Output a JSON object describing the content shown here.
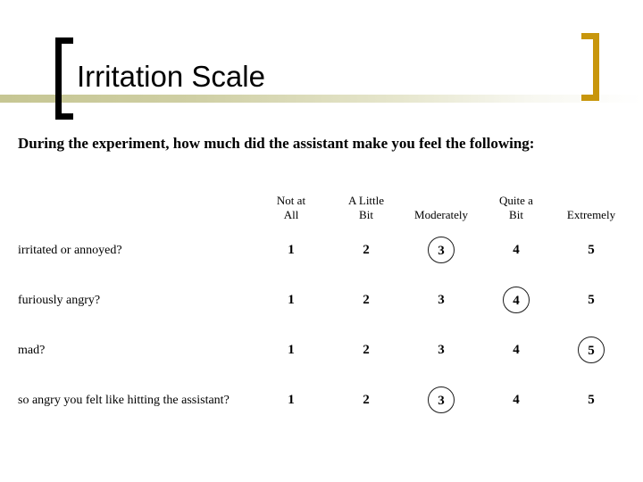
{
  "slide": {
    "title": "Irritation Scale",
    "prompt": "During the experiment, how much did the assistant make you feel the following:"
  },
  "decor": {
    "bracket_left_color": "#000000",
    "bracket_right_color": "#c8960c",
    "rule_color": "#c6c693",
    "background": "#ffffff"
  },
  "scale": {
    "label_column_header": "",
    "headers": [
      "Not at All",
      "A Little Bit",
      "Moderately",
      "Quite a Bit",
      "Extremely"
    ],
    "header_lines": [
      [
        "Not at",
        "All"
      ],
      [
        "A Little",
        "Bit"
      ],
      [
        "",
        "Moderately"
      ],
      [
        "Quite a",
        "Bit"
      ],
      [
        "",
        "Extremely"
      ]
    ],
    "option_values": [
      "1",
      "2",
      "3",
      "4",
      "5"
    ],
    "rows": [
      {
        "label": "irritated or annoyed?",
        "values": [
          "1",
          "2",
          "3",
          "4",
          "5"
        ],
        "selected_index": 2,
        "selected_value": "3"
      },
      {
        "label": "furiously angry?",
        "values": [
          "1",
          "2",
          "3",
          "4",
          "5"
        ],
        "selected_index": 3,
        "selected_value": "4"
      },
      {
        "label": "mad?",
        "values": [
          "1",
          "2",
          "3",
          "4",
          "5"
        ],
        "selected_index": 4,
        "selected_value": "5"
      },
      {
        "label": "so angry you felt like hitting the assistant?",
        "values": [
          "1",
          "2",
          "3",
          "4",
          "5"
        ],
        "selected_index": 2,
        "selected_value": "3"
      }
    ]
  }
}
